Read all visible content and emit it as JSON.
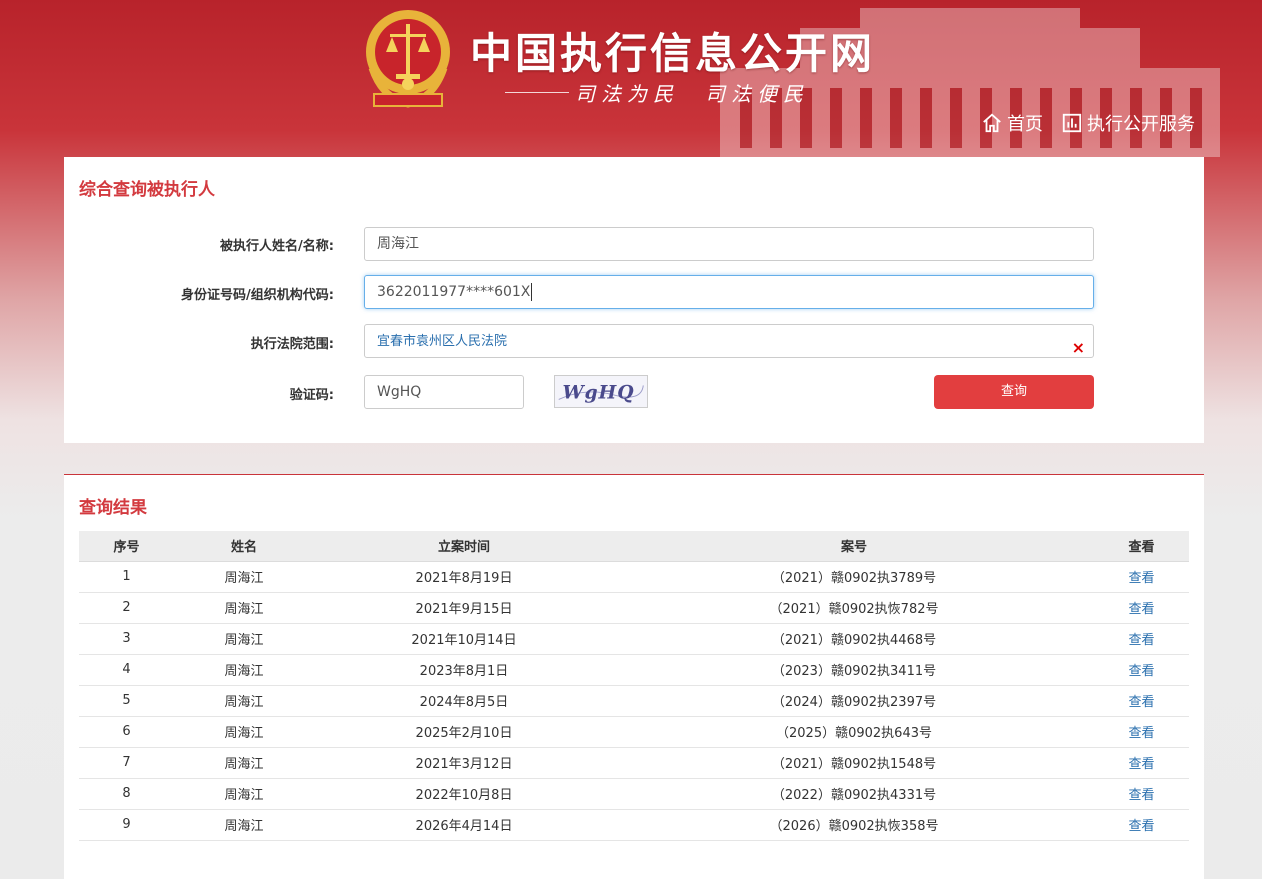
{
  "header": {
    "site_title": "中国执行信息公开网",
    "slogan": "司法为民　司法便民",
    "nav": [
      {
        "label": "首页",
        "icon": "home-icon"
      },
      {
        "label": "执行公开服务",
        "icon": "chart-icon"
      }
    ]
  },
  "search": {
    "title": "综合查询被执行人",
    "name_label": "被执行人姓名/名称:",
    "name_value": "周海江",
    "id_label": "身份证号码/组织机构代码:",
    "id_value": "3622011977****601X",
    "court_label": "执行法院范围:",
    "court_value": "宜春市袁州区人民法院",
    "clear_icon": "×",
    "captcha_label": "验证码:",
    "captcha_value": "WgHQ",
    "captcha_image_text": "WgHQ",
    "query_button": "查询"
  },
  "results": {
    "title": "查询结果",
    "columns": [
      "序号",
      "姓名",
      "立案时间",
      "案号",
      "查看"
    ],
    "rows": [
      {
        "no": "1",
        "name": "周海江",
        "date": "2021年8月19日",
        "case": "（2021）赣0902执3789号",
        "view": "查看"
      },
      {
        "no": "2",
        "name": "周海江",
        "date": "2021年9月15日",
        "case": "（2021）赣0902执恢782号",
        "view": "查看"
      },
      {
        "no": "3",
        "name": "周海江",
        "date": "2021年10月14日",
        "case": "（2021）赣0902执4468号",
        "view": "查看"
      },
      {
        "no": "4",
        "name": "周海江",
        "date": "2023年8月1日",
        "case": "（2023）赣0902执3411号",
        "view": "查看"
      },
      {
        "no": "5",
        "name": "周海江",
        "date": "2024年8月5日",
        "case": "（2024）赣0902执2397号",
        "view": "查看"
      },
      {
        "no": "6",
        "name": "周海江",
        "date": "2025年2月10日",
        "case": "（2025）赣0902执643号",
        "view": "查看"
      },
      {
        "no": "7",
        "name": "周海江",
        "date": "2021年3月12日",
        "case": "（2021）赣0902执1548号",
        "view": "查看"
      },
      {
        "no": "8",
        "name": "周海江",
        "date": "2022年10月8日",
        "case": "（2022）赣0902执4331号",
        "view": "查看"
      },
      {
        "no": "9",
        "name": "周海江",
        "date": "2026年4月14日",
        "case": "（2026）赣0902执恢358号",
        "view": "查看"
      }
    ]
  },
  "colors": {
    "brand_red": "#c9343a",
    "title_red": "#d33a3f",
    "button_red": "#e23e3f",
    "link_blue": "#2a6fae"
  }
}
